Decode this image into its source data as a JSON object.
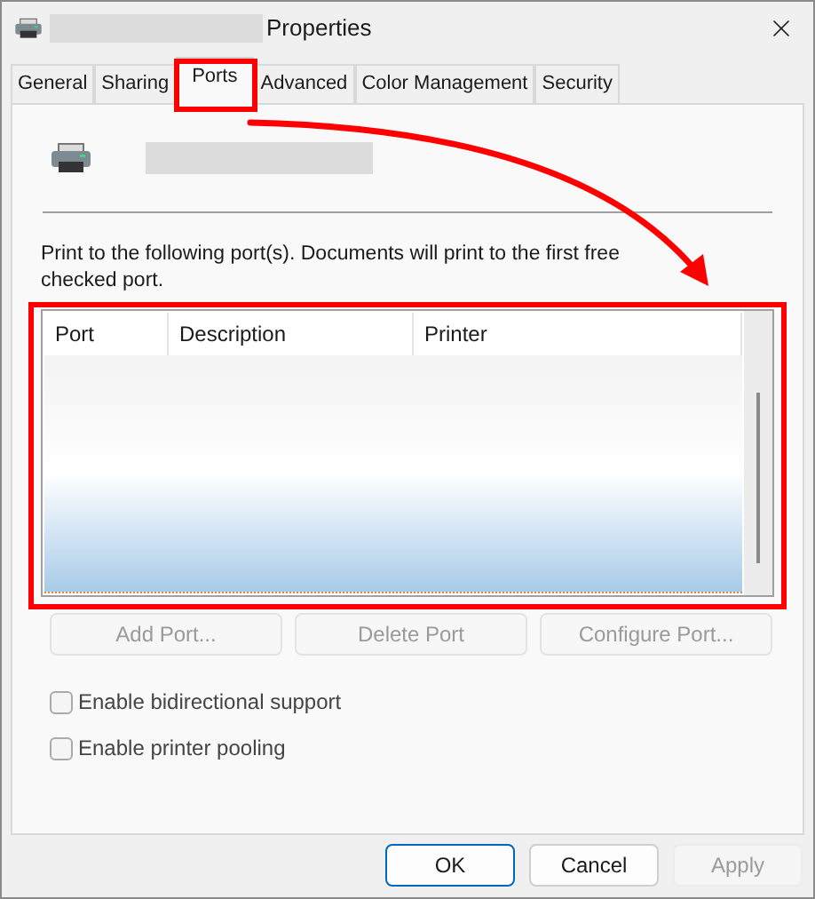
{
  "window": {
    "title": "Properties"
  },
  "tabs": [
    {
      "label": "General",
      "selected": false
    },
    {
      "label": "Sharing",
      "selected": false
    },
    {
      "label": "Ports",
      "selected": true
    },
    {
      "label": "Advanced",
      "selected": false
    },
    {
      "label": "Color Management",
      "selected": false
    },
    {
      "label": "Security",
      "selected": false
    }
  ],
  "description": "Print to the following port(s). Documents will print to the first free checked port.",
  "port_list": {
    "columns": [
      "Port",
      "Description",
      "Printer"
    ]
  },
  "port_buttons": [
    {
      "label": "Add Port...",
      "disabled": true
    },
    {
      "label": "Delete Port",
      "disabled": true
    },
    {
      "label": "Configure Port...",
      "disabled": true
    }
  ],
  "options": [
    {
      "label": "Enable bidirectional support",
      "checked": false
    },
    {
      "label": "Enable printer pooling",
      "checked": false
    }
  ],
  "footer_buttons": [
    {
      "label": "OK",
      "disabled": false,
      "default": true
    },
    {
      "label": "Cancel",
      "disabled": false,
      "default": false
    },
    {
      "label": "Apply",
      "disabled": true,
      "default": false
    }
  ]
}
